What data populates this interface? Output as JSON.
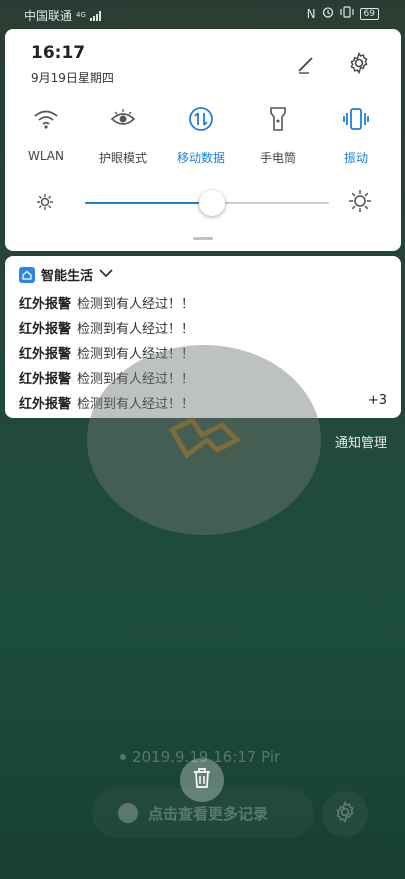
{
  "status_bar": {
    "carrier": "中国联通",
    "network": "4G",
    "battery": "69"
  },
  "quick_panel": {
    "time": "16:17",
    "date": "9月19日星期四",
    "tiles": [
      {
        "label": "WLAN",
        "icon": "wifi-icon",
        "active": false
      },
      {
        "label": "护眼模式",
        "icon": "eye-icon",
        "active": false
      },
      {
        "label": "移动数据",
        "icon": "mobile-data-icon",
        "active": true
      },
      {
        "label": "手电筒",
        "icon": "flashlight-icon",
        "active": false
      },
      {
        "label": "振动",
        "icon": "vibrate-icon",
        "active": true
      }
    ],
    "brightness": 0.52,
    "accent": "#1e7fd8"
  },
  "notification": {
    "app_name": "智能生活",
    "lines": [
      {
        "title": "红外报警",
        "body": "检测到有人经过！！"
      },
      {
        "title": "红外报警",
        "body": "检测到有人经过！！"
      },
      {
        "title": "红外报警",
        "body": "检测到有人经过！！"
      },
      {
        "title": "红外报警",
        "body": "检测到有人经过！！"
      },
      {
        "title": "红外报警",
        "body": "检测到有人经过！！"
      }
    ],
    "more_count": "+3"
  },
  "manage_label": "通知管理",
  "background_app": {
    "record_timestamp": "2019.9.19 16:17 Pir",
    "view_more_label": "点击查看更多记录"
  }
}
